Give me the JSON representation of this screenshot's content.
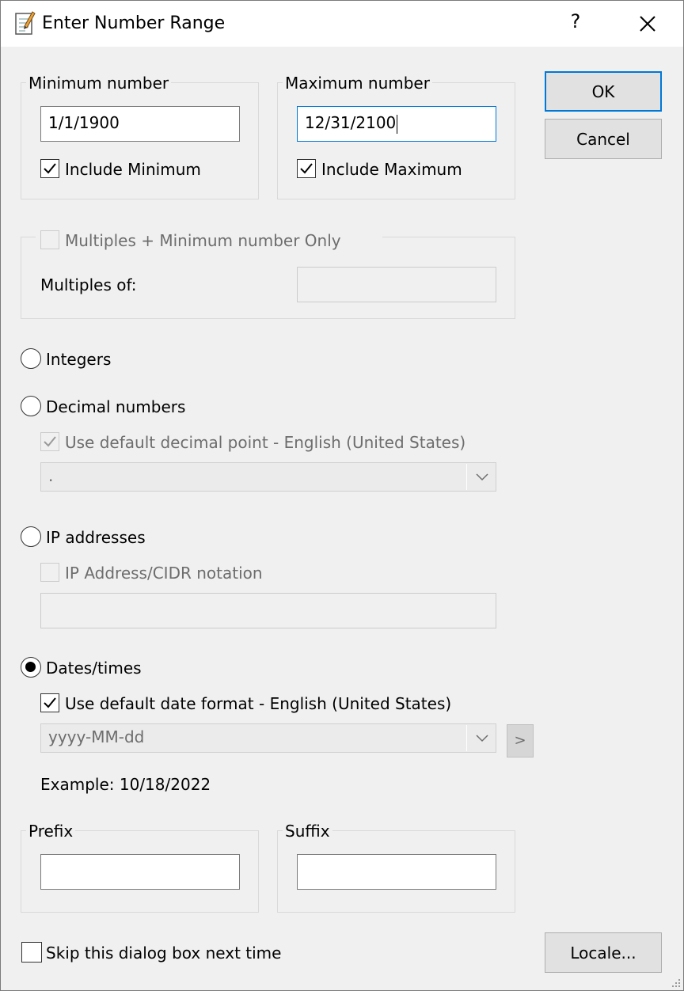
{
  "window": {
    "title": "Enter Number Range",
    "app_icon": "notepad-icon",
    "help_label": "?",
    "close_icon": "close-icon"
  },
  "minimum": {
    "legend": "Minimum number",
    "value": "1/1/1900",
    "include_label": "Include Minimum",
    "include_checked": true
  },
  "maximum": {
    "legend": "Maximum number",
    "value": "12/31/2100",
    "include_label": "Include Maximum",
    "include_checked": true
  },
  "buttons": {
    "ok": "OK",
    "cancel": "Cancel",
    "locale": "Locale...",
    "more": ">"
  },
  "multiples": {
    "checkbox_label": "Multiples + Minimum number Only",
    "checked": false,
    "field_label": "Multiples of:",
    "value": ""
  },
  "types": {
    "integers": "Integers",
    "decimal": "Decimal numbers",
    "decimal_default_label": "Use default decimal point - English (United States)",
    "decimal_default_checked": true,
    "decimal_point_value": ".",
    "ip": "IP addresses",
    "ip_cidr_label": "IP Address/CIDR notation",
    "ip_cidr_checked": false,
    "ip_value": "",
    "dates": "Dates/times",
    "selected": "Dates/times",
    "date_default_label": "Use default date format - English (United States)",
    "date_default_checked": true,
    "date_format_value": "yyyy-MM-dd",
    "example": "Example: 10/18/2022"
  },
  "prefix": {
    "legend": "Prefix",
    "value": ""
  },
  "suffix": {
    "legend": "Suffix",
    "value": ""
  },
  "skip": {
    "label": "Skip this dialog box next time",
    "checked": false
  },
  "colors": {
    "accent": "#0078d7",
    "face": "#f0f0f0",
    "button": "#e1e1e1"
  }
}
